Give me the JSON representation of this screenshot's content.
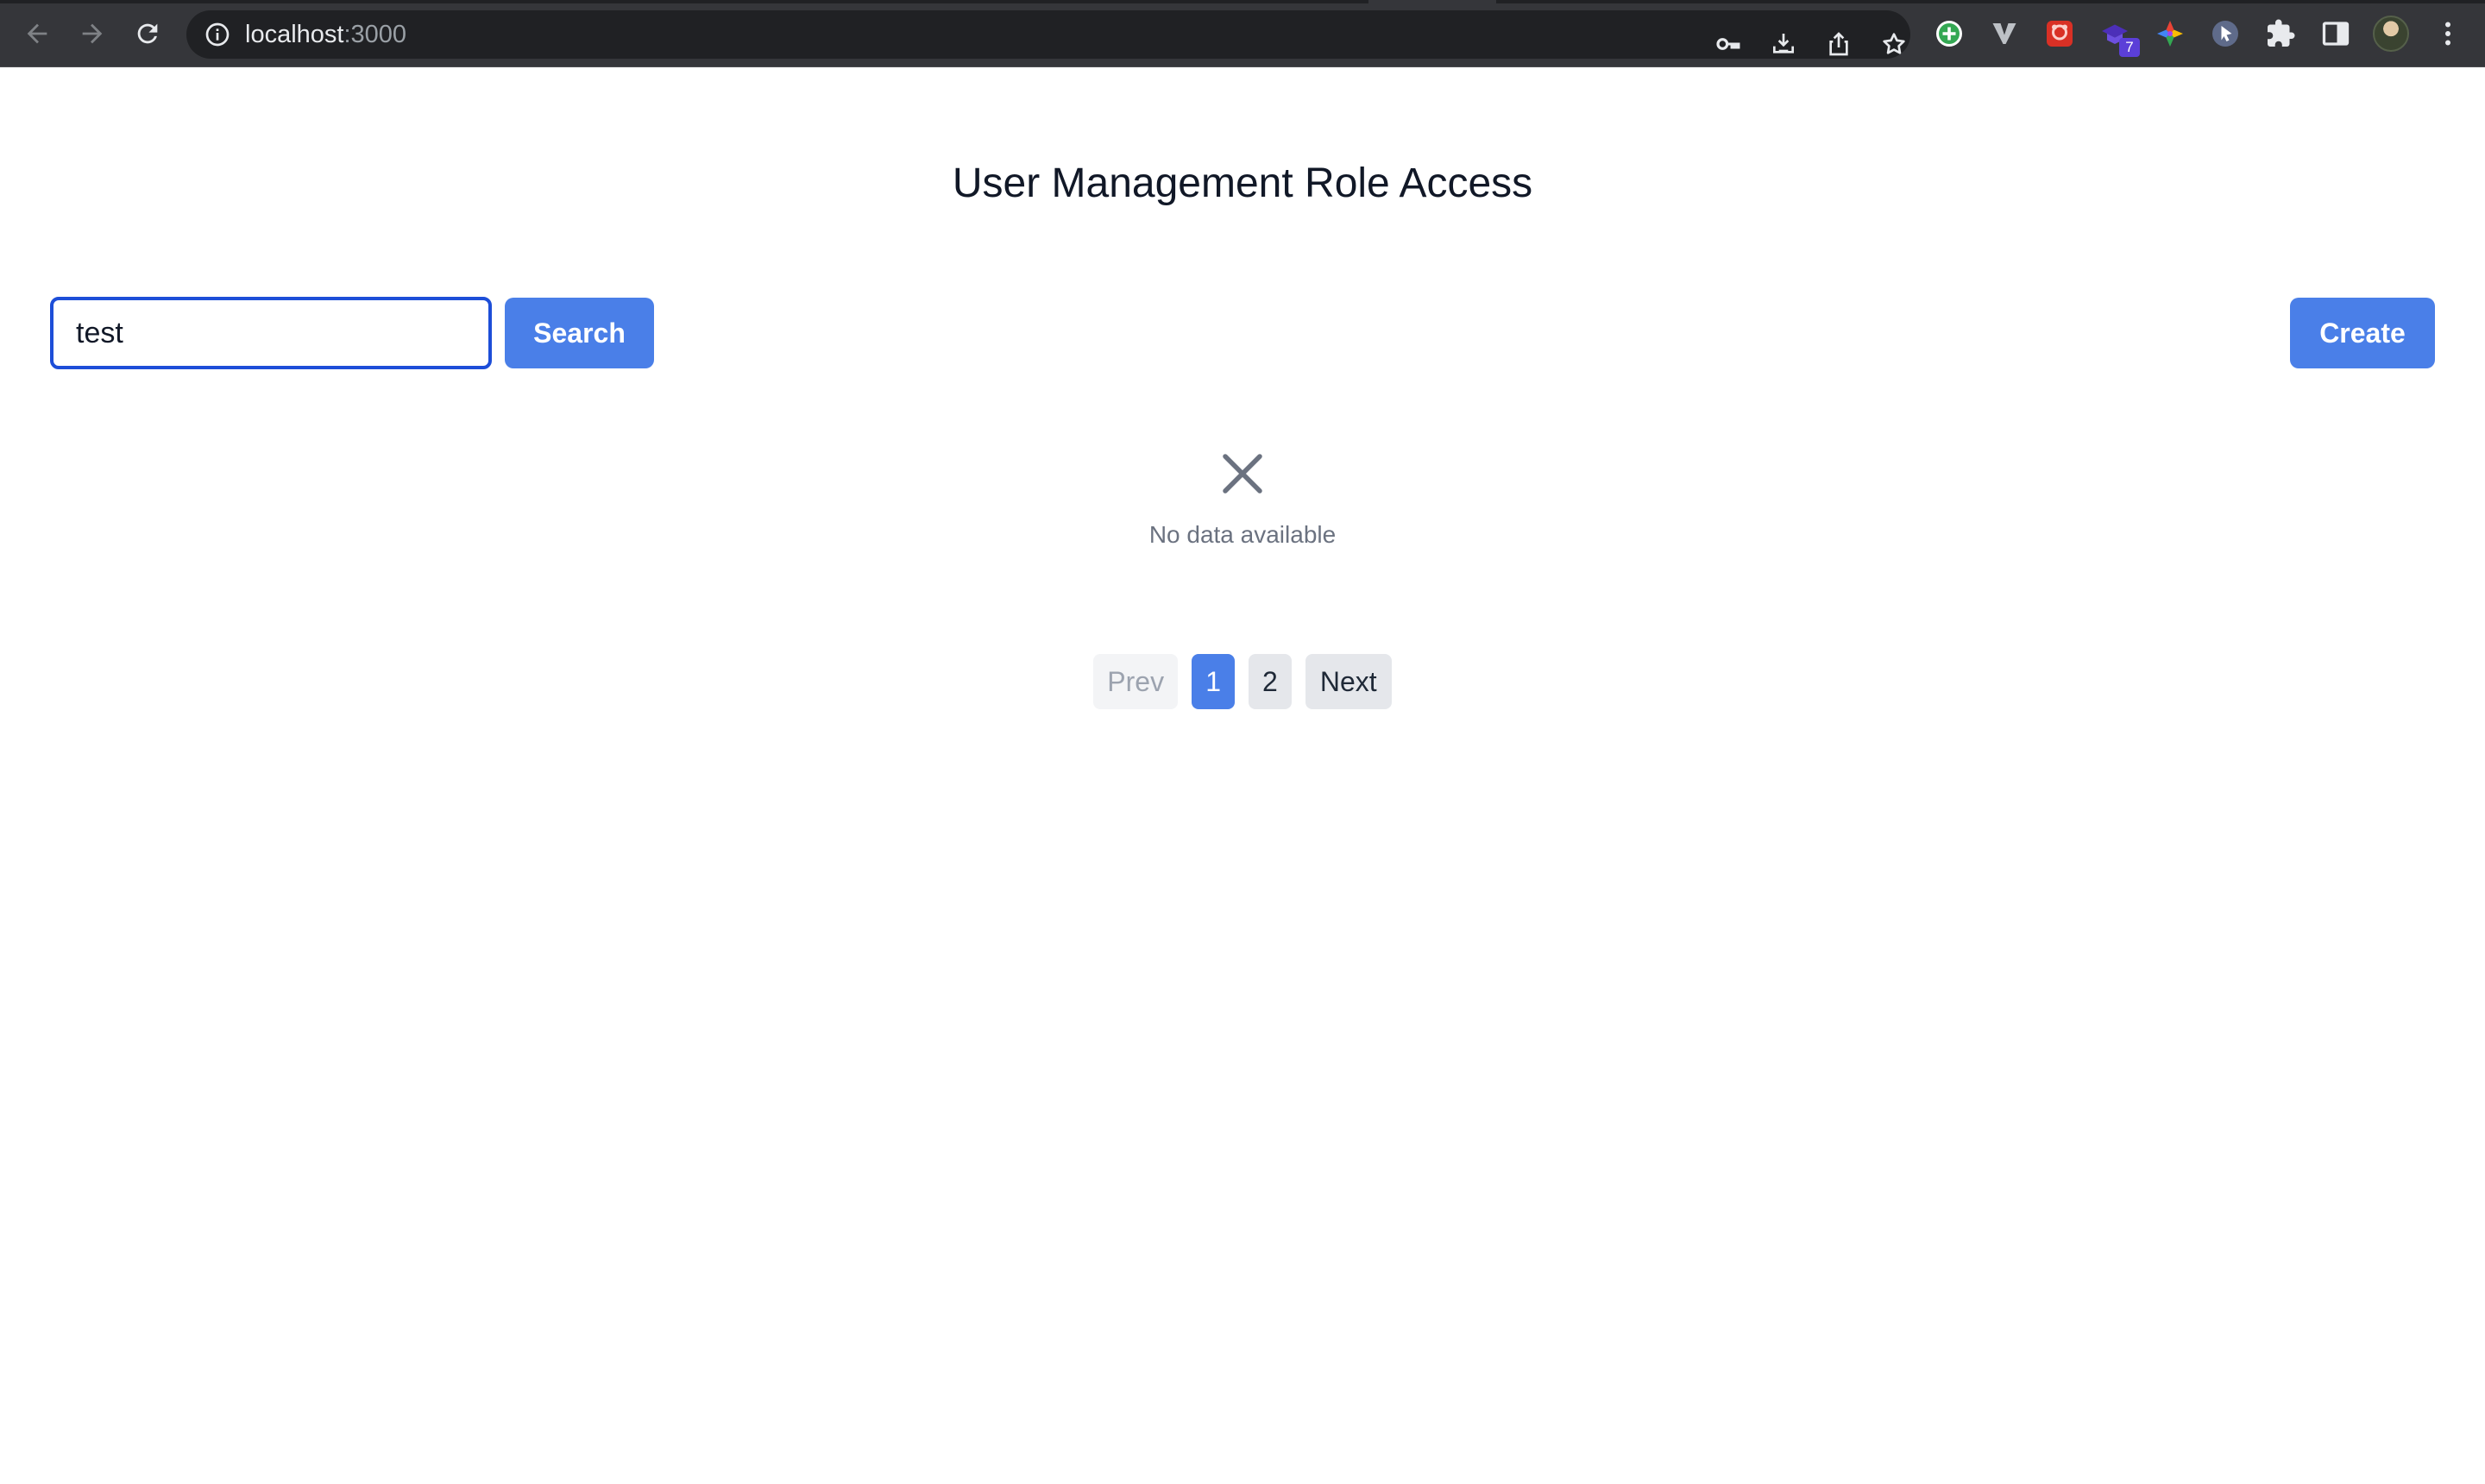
{
  "browser": {
    "url_host": "localhost",
    "url_port": ":3000",
    "extensions": [
      {
        "icon": "plus-circle-icon",
        "color": "#34a853"
      },
      {
        "icon": "vimium-v-icon",
        "color": "#bdc1c6"
      },
      {
        "icon": "red-ext-icon",
        "color": "#d93025"
      },
      {
        "icon": "purple-ext-icon",
        "color": "#5b3fd8",
        "badge": "7"
      },
      {
        "icon": "color-wheel-icon",
        "color": "#f4b400"
      },
      {
        "icon": "cursor-ext-icon",
        "color": "#8ab4f8"
      }
    ]
  },
  "page": {
    "title": "User Management Role Access"
  },
  "toolbar": {
    "search_value": "test",
    "search_label": "Search",
    "create_label": "Create"
  },
  "empty_state": {
    "icon": "close-x-icon",
    "message": "No data available"
  },
  "pagination": {
    "prev_label": "Prev",
    "next_label": "Next",
    "pages": [
      "1",
      "2"
    ],
    "current_page": "1"
  },
  "colors": {
    "accent": "#4a7fe8",
    "input_focus": "#1d4ed8",
    "muted_text": "#6b7280"
  }
}
